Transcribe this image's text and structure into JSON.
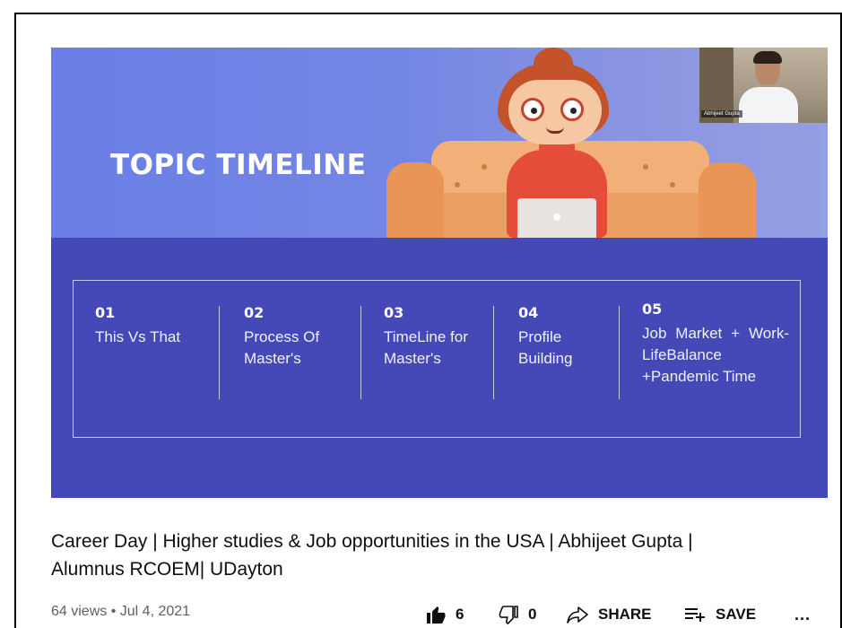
{
  "video": {
    "slide_title": "TOPIC TIMELINE",
    "webcam_name": "Abhijeet Gupta",
    "timeline": [
      {
        "num": "01",
        "text": "This Vs That"
      },
      {
        "num": "02",
        "text": "Process Of Master's"
      },
      {
        "num": "03",
        "text": "TimeLine for Master's"
      },
      {
        "num": "04",
        "text": "Profile Building"
      },
      {
        "num": "05",
        "text": "Job Market + Work-LifeBalance +Pandemic Time"
      }
    ]
  },
  "title": {
    "line1": "Career Day | Higher studies & Job opportunities in the USA | Abhijeet Gupta |",
    "line2": "Alumnus RCOEM| UDayton"
  },
  "meta": {
    "views": "64 views",
    "separator": "•",
    "date": "Jul 4, 2021"
  },
  "actions": {
    "likes": "6",
    "dislikes": "0",
    "share_label": "SHARE",
    "save_label": "SAVE",
    "more_label": "..."
  },
  "icons": {
    "like": "thumbs-up-icon",
    "dislike": "thumbs-down-icon",
    "share": "share-arrow-icon",
    "save": "playlist-add-icon",
    "more": "more-horizontal-icon"
  },
  "colors": {
    "slide_top": "#7486e4",
    "slide_bottom": "#4549b8",
    "text_primary": "#0f0f0f",
    "text_secondary": "#606060"
  }
}
